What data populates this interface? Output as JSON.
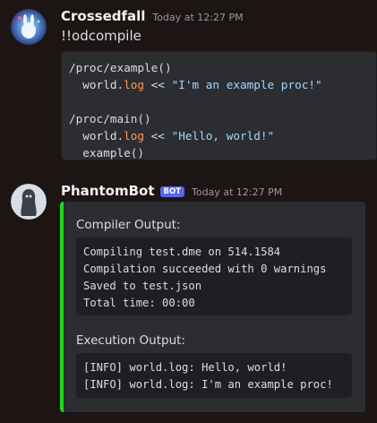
{
  "messages": [
    {
      "username": "Crossedfall",
      "timestamp": "Today at 12:27 PM",
      "text": "!!odcompile",
      "code_lines": [
        [
          "/proc/example()"
        ],
        [
          "  world.",
          {
            "kw": "log"
          },
          " << ",
          {
            "str": "\"I'm an example proc!\""
          }
        ],
        [
          ""
        ],
        [
          "/proc/main()"
        ],
        [
          "  world.",
          {
            "kw": "log"
          },
          " << ",
          {
            "str": "\"Hello, world!\""
          }
        ],
        [
          "  example()"
        ]
      ]
    },
    {
      "username": "PhantomBot",
      "bot_tag": "BOT",
      "timestamp": "Today at 12:27 PM",
      "embed": {
        "accent_color": "#1ed81e",
        "fields": [
          {
            "name": "Compiler Output:",
            "lines": [
              "Compiling test.dme on 514.1584",
              "Compilation succeeded with 0 warnings",
              "Saved to test.json",
              "Total time: 00:00"
            ]
          },
          {
            "name": "Execution Output:",
            "lines": [
              "[INFO] world.log: Hello, world!",
              "[INFO] world.log: I'm an example proc!"
            ]
          }
        ]
      }
    }
  ]
}
